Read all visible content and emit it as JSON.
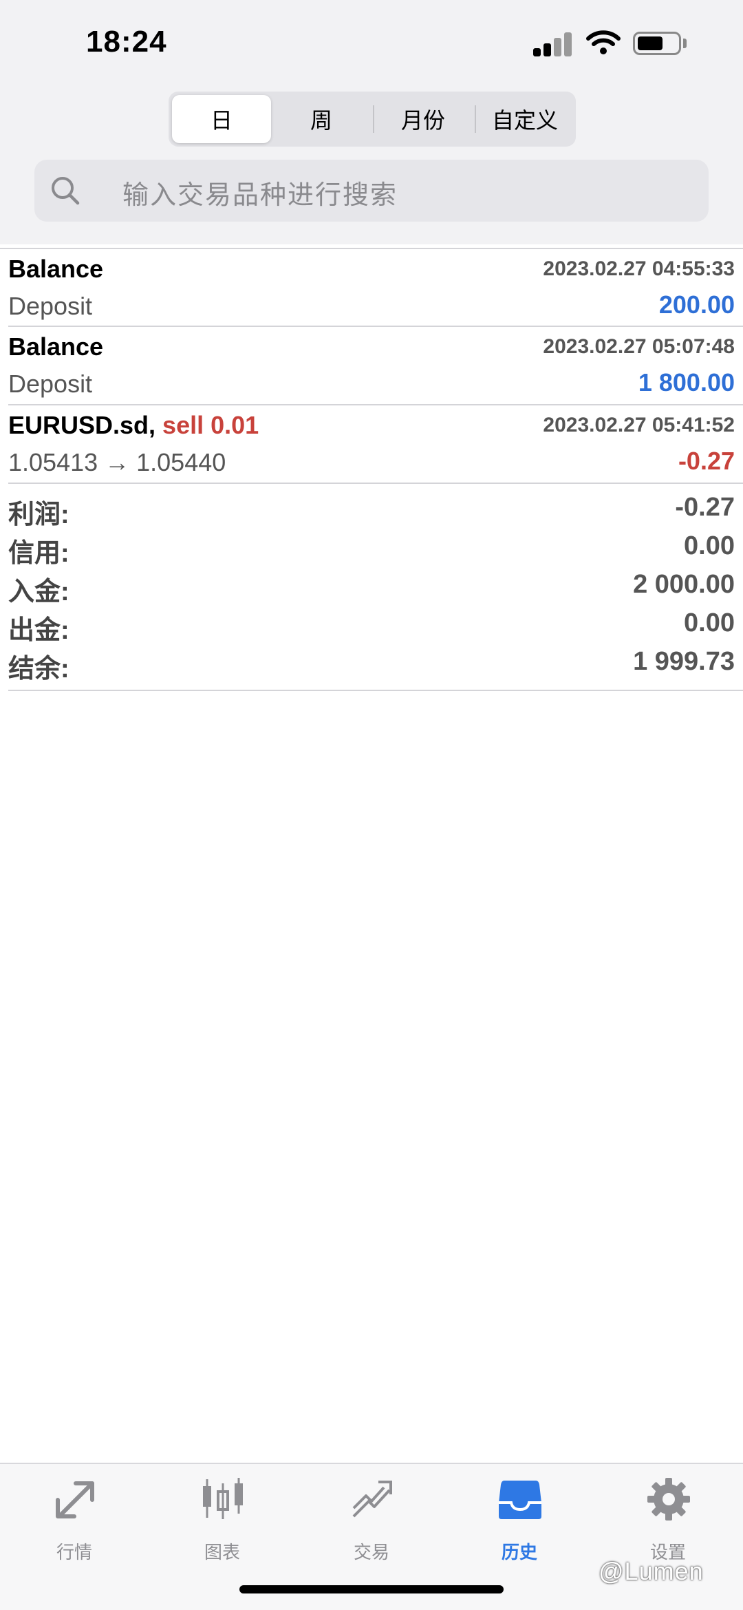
{
  "status_bar": {
    "time": "18:24"
  },
  "period_tabs": [
    {
      "label": "日",
      "active": true
    },
    {
      "label": "周",
      "active": false
    },
    {
      "label": "月份",
      "active": false
    },
    {
      "label": "自定义",
      "active": false
    }
  ],
  "search": {
    "placeholder": "输入交易品种进行搜索"
  },
  "history": [
    {
      "title": "Balance",
      "date": "2023.02.27 04:55:33",
      "subtitle": "Deposit",
      "value": "200.00"
    },
    {
      "title": "Balance",
      "date": "2023.02.27 05:07:48",
      "subtitle": "Deposit",
      "value": "1 800.00"
    },
    {
      "symbol": "EURUSD.sd,",
      "action": "sell 0.01",
      "date": "2023.02.27 05:41:52",
      "subtitle": "1.05413 → 1.05440",
      "value": "-0.27"
    }
  ],
  "summary": [
    {
      "label": "利润:",
      "value": "-0.27"
    },
    {
      "label": "信用:",
      "value": "0.00"
    },
    {
      "label": "入金:",
      "value": "2 000.00"
    },
    {
      "label": "出金:",
      "value": "0.00"
    },
    {
      "label": "结余:",
      "value": "1 999.73"
    }
  ],
  "tabbar": [
    {
      "label": "行情",
      "icon": "quotes-arrows-icon"
    },
    {
      "label": "图表",
      "icon": "candlestick-chart-icon"
    },
    {
      "label": "交易",
      "icon": "trade-trend-icon"
    },
    {
      "label": "历史",
      "icon": "history-inbox-icon",
      "active": true
    },
    {
      "label": "设置",
      "icon": "gear-icon"
    }
  ],
  "watermark": "@Lumen",
  "colors": {
    "accent_blue": "#2e6fd6",
    "loss_red": "#c8423b",
    "tab_active": "#2e78e4"
  }
}
